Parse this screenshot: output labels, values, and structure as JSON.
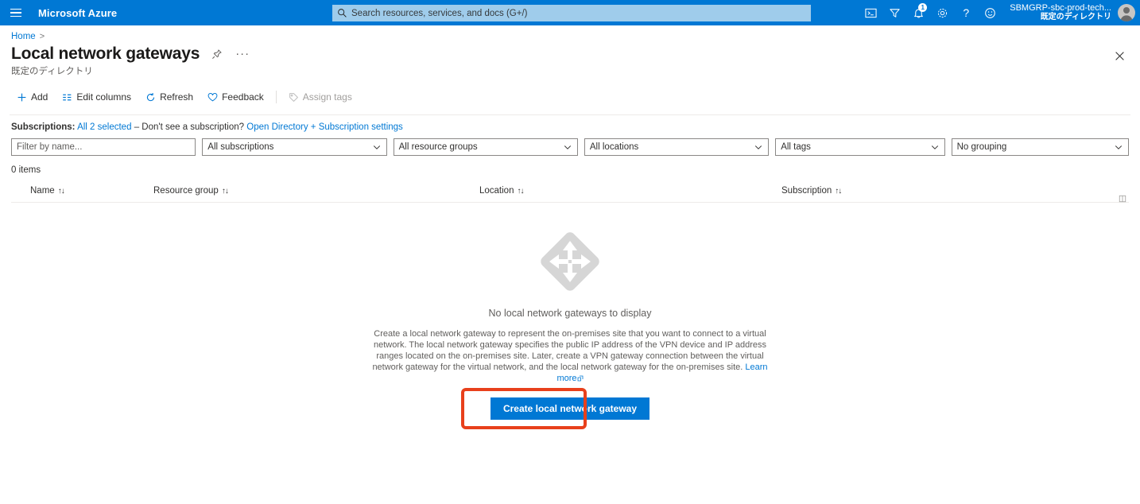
{
  "topbar": {
    "menu_icon": "hamburger-icon",
    "brand": "Microsoft Azure",
    "search": {
      "placeholder": "Search resources, services, and docs (G+/)",
      "value": "",
      "icon": "search-icon"
    },
    "icons": [
      {
        "name": "cloud-shell-icon",
        "glyph": ">_"
      },
      {
        "name": "directories-subscriptions-icon",
        "glyph": "filter"
      },
      {
        "name": "notifications-icon",
        "glyph": "bell",
        "badge": "1"
      },
      {
        "name": "settings-icon",
        "glyph": "gear"
      },
      {
        "name": "help-icon",
        "glyph": "?"
      },
      {
        "name": "feedback-icon",
        "glyph": "smiley"
      }
    ],
    "account": {
      "name": "SBMGRP-sbc-prod-tech...",
      "directory": "既定のディレクトリ"
    },
    "accent_color": "#0078D4"
  },
  "breadcrumb": {
    "home": "Home",
    "separator": ">"
  },
  "page": {
    "title": "Local network gateways",
    "subtitle": "既定のディレクトリ",
    "pin_icon": "pin-icon",
    "more_icon": "ellipsis-icon",
    "close_icon": "close-icon"
  },
  "commandbar": {
    "items": [
      {
        "label": "Add",
        "icon": "plus-icon",
        "disabled": false
      },
      {
        "label": "Edit columns",
        "icon": "columns-icon",
        "disabled": false
      },
      {
        "label": "Refresh",
        "icon": "refresh-icon",
        "disabled": false
      },
      {
        "label": "Feedback",
        "icon": "heart-icon",
        "disabled": false
      },
      {
        "label": "Assign tags",
        "icon": "tag-icon",
        "disabled": true
      }
    ]
  },
  "subscriptions": {
    "label": "Subscriptions:",
    "selected": "All 2 selected",
    "dash_text": "– Don't see a subscription?",
    "settings_link": "Open Directory + Subscription settings"
  },
  "filters": {
    "name": {
      "placeholder": "Filter by name...",
      "value": ""
    },
    "subscriptions": "All subscriptions",
    "resource_groups": "All resource groups",
    "locations": "All locations",
    "tags": "All tags",
    "grouping": "No grouping",
    "chevron_icon": "chevron-down-icon"
  },
  "table": {
    "count": "0 items",
    "columns": [
      {
        "label": "Name",
        "sort_icon": "sort-arrows-icon"
      },
      {
        "label": "Resource group",
        "sort_icon": "sort-arrows-icon"
      },
      {
        "label": "Location",
        "sort_icon": "sort-arrows-icon"
      },
      {
        "label": "Subscription",
        "sort_icon": "sort-arrows-icon"
      }
    ],
    "rows": [],
    "column_options_icon": "column-options-icon"
  },
  "empty_state": {
    "icon": "local-network-gateway-icon",
    "title": "No local network gateways to display",
    "description": "Create a local network gateway to represent the on-premises site that you want to connect to a virtual network. The local network gateway specifies the public IP address of the VPN device and IP address ranges located on the on-premises site. Later, create a VPN gateway connection between the virtual network gateway for the virtual network, and the local network gateway for the on-premises site.",
    "learn_more": "Learn more",
    "external_link_icon": "external-link-icon",
    "cta_label": "Create local network gateway",
    "annotation_color": "#E8401C"
  }
}
